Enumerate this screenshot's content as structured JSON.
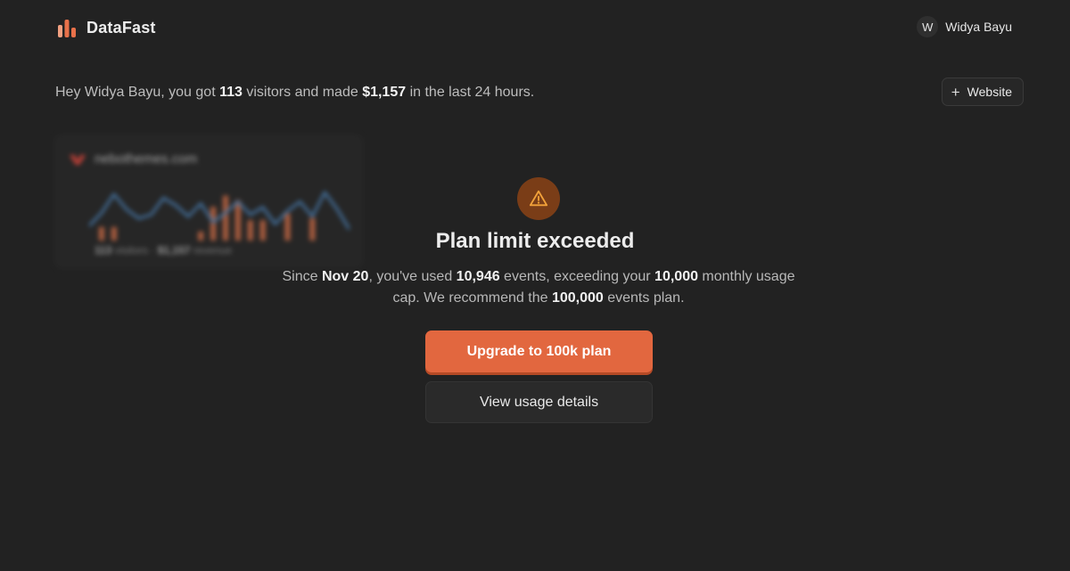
{
  "header": {
    "brand": "DataFast",
    "brand_icon": "bar-chart-logo-icon",
    "user_initial": "W",
    "user_name": "Widya Bayu"
  },
  "greeting": {
    "prefix": "Hey Widya Bayu, you got ",
    "visitors": "113",
    "middle": " visitors and made ",
    "revenue": "$1,157",
    "suffix": " in the last 24 hours."
  },
  "add_website": {
    "icon": "plus-icon",
    "label": "Website"
  },
  "site_card": {
    "domain": "nebothemes.com",
    "visitors": "113",
    "visitors_label": "visitors",
    "separator": "·",
    "revenue": "$1,157",
    "revenue_label": "revenue",
    "series": {
      "line": [
        5,
        12,
        22,
        14,
        9,
        11,
        20,
        16,
        10,
        17,
        7,
        12,
        18,
        11,
        15,
        6,
        13,
        18,
        10,
        23,
        14,
        3
      ],
      "bars": [
        0,
        6,
        6,
        0,
        0,
        0,
        0,
        0,
        0,
        4,
        15,
        20,
        18,
        9,
        9,
        0,
        12,
        0,
        10,
        0,
        0,
        0
      ]
    },
    "colors": {
      "line": "#4a7fb3",
      "bars": "#c96a45"
    }
  },
  "modal": {
    "icon": "warning-triangle-icon",
    "title": "Plan limit exceeded",
    "desc": {
      "t1": "Since ",
      "date": "Nov 20",
      "t2": ", you've used ",
      "used": "10,946",
      "t3": " events, exceeding your ",
      "cap": "10,000",
      "t4": " monthly usage cap. We recommend the ",
      "plan": "100,000",
      "t5": " events plan."
    },
    "primary_button": "Upgrade to 100k plan",
    "secondary_button": "View usage details"
  },
  "colors": {
    "background": "#222222",
    "accent": "#e2673f",
    "warning_bg": "#7a3d17",
    "warning_fg": "#f2a23a"
  }
}
